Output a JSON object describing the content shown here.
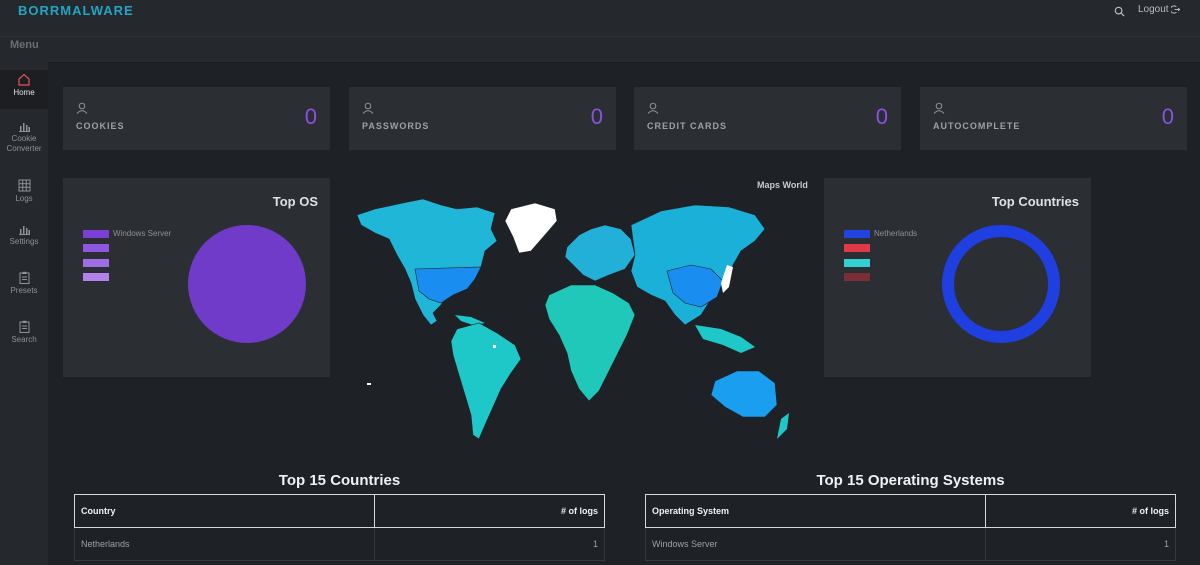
{
  "brand": "BORRMALWARE",
  "header": {
    "logout_label": "Logout"
  },
  "sidebar": {
    "title": "Menu",
    "items": [
      {
        "label": "Home",
        "icon": "home-icon"
      },
      {
        "label": "Cookie Converter",
        "icon": "bar-chart-icon"
      },
      {
        "label": "Logs",
        "icon": "grid-icon"
      },
      {
        "label": "Settings",
        "icon": "bar-chart-icon"
      },
      {
        "label": "Presets",
        "icon": "clipboard-icon"
      },
      {
        "label": "Search",
        "icon": "clipboard-icon"
      }
    ]
  },
  "stats": [
    {
      "label": "COOKIES",
      "value": "0",
      "icon": "user-icon"
    },
    {
      "label": "PASSWORDS",
      "value": "0",
      "icon": "user-icon"
    },
    {
      "label": "CREDIT CARDS",
      "value": "0",
      "icon": "user-icon"
    },
    {
      "label": "AUTOCOMPLETE",
      "value": "0",
      "icon": "user-icon"
    }
  ],
  "top_os": {
    "title": "Top OS",
    "legend": [
      "Windows Server",
      "",
      "",
      ""
    ],
    "colors": [
      "#7b3fd6",
      "#8f56e0",
      "#a06de6",
      "#b083ea"
    ]
  },
  "map": {
    "title": "Maps World"
  },
  "top_countries": {
    "title": "Top Countries",
    "legend": [
      "Netherlands",
      "",
      "",
      ""
    ],
    "colors": [
      "#2343e0",
      "#e0394a",
      "#32d0d0",
      "#7a2e36"
    ]
  },
  "countries_table": {
    "title": "Top 15 Countries",
    "headers": [
      "Country",
      "# of logs"
    ],
    "rows": [
      [
        "Netherlands",
        "1"
      ]
    ]
  },
  "os_table": {
    "title": "Top 15 Operating Systems",
    "headers": [
      "Operating System",
      "# of logs"
    ],
    "rows": [
      [
        "Windows Server",
        "1"
      ]
    ]
  },
  "chart_data": [
    {
      "type": "pie",
      "title": "Top OS",
      "categories": [
        "Windows Server"
      ],
      "values": [
        1
      ]
    },
    {
      "type": "pie",
      "title": "Top Countries",
      "categories": [
        "Netherlands"
      ],
      "values": [
        1
      ]
    }
  ]
}
